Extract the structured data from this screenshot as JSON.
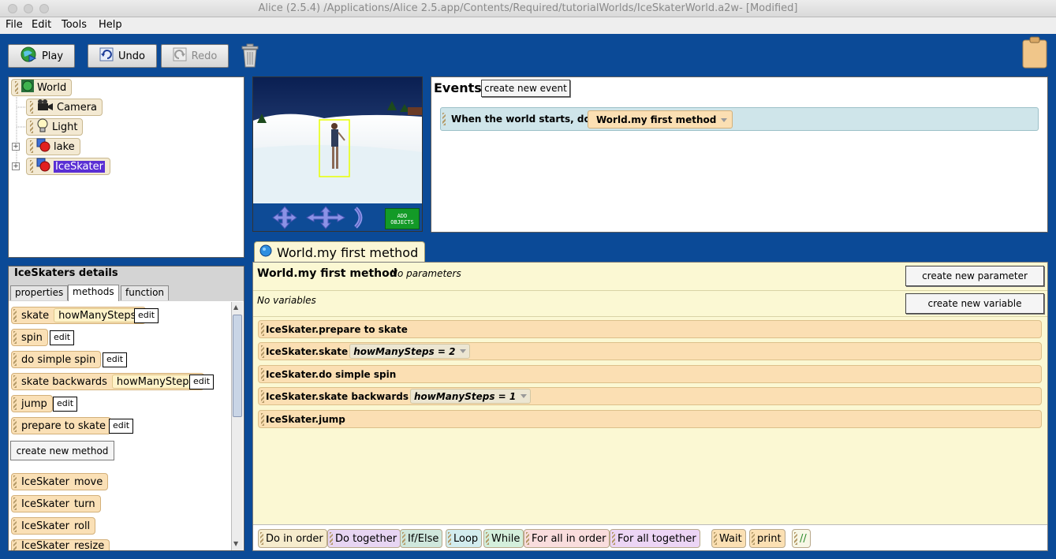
{
  "window": {
    "title": "Alice (2.5.4) /Applications/Alice 2.5.app/Contents/Required/tutorialWorlds/IceSkaterWorld.a2w-  [Modified]"
  },
  "menu": [
    {
      "label": "File"
    },
    {
      "label": "Edit"
    },
    {
      "label": "Tools"
    },
    {
      "label": "Help"
    }
  ],
  "toolbar": {
    "play": "Play",
    "undo": "Undo",
    "redo": "Redo"
  },
  "object_tree": {
    "world": "World",
    "camera": "Camera",
    "light": "Light",
    "lake": "lake",
    "iceskater": "IceSkater"
  },
  "scene": {
    "add_objects": "ADD\nOBJECTS"
  },
  "details": {
    "title": "IceSkaters details",
    "tabs": {
      "properties": "properties",
      "methods": "methods",
      "function": "function"
    },
    "edit_label": "edit",
    "methods": [
      {
        "name": "skate",
        "param": "howManySteps"
      },
      {
        "name": "spin",
        "param": ""
      },
      {
        "name": "do simple spin",
        "param": ""
      },
      {
        "name": "skate backwards",
        "param": "howManySteps"
      },
      {
        "name": "jump",
        "param": ""
      },
      {
        "name": "prepare to skate",
        "param": ""
      }
    ],
    "create_new_method": "create new method",
    "builtin": [
      {
        "obj": "IceSkater",
        "name": "move"
      },
      {
        "obj": "IceSkater",
        "name": "turn"
      },
      {
        "obj": "IceSkater",
        "name": "roll"
      },
      {
        "obj": "IceSkater",
        "name": "resize"
      }
    ]
  },
  "events": {
    "title": "Events",
    "create_new_event": "create new event",
    "when_text": "When the world starts,  do",
    "method": "World.my first method"
  },
  "editor": {
    "tab_label": "World.my first method",
    "header_name": "World.my first method",
    "no_parameters": "No parameters",
    "no_variables": "No variables",
    "create_new_parameter": "create new parameter",
    "create_new_variable": "create new variable",
    "statements": [
      {
        "text": "IceSkater.prepare to skate",
        "arg": ""
      },
      {
        "text": "IceSkater.skate",
        "arg": "howManySteps = 2"
      },
      {
        "text": "IceSkater.do simple spin",
        "arg": ""
      },
      {
        "text": "IceSkater.skate backwards",
        "arg": "howManySteps = 1"
      },
      {
        "text": "IceSkater.jump",
        "arg": ""
      }
    ]
  },
  "controls": [
    {
      "label": "Do in order",
      "color": "#f6eccd"
    },
    {
      "label": "Do together",
      "color": "#e7d5f3"
    },
    {
      "label": "If/Else",
      "color": "#cfe7dc"
    },
    {
      "label": "Loop",
      "color": "#d2ecee"
    },
    {
      "label": "While",
      "color": "#d4efdc"
    },
    {
      "label": "For all in order",
      "color": "#f9dddd"
    },
    {
      "label": "For all together",
      "color": "#ecd5f5"
    },
    {
      "label": "Wait",
      "color": "#fbe0b3"
    },
    {
      "label": "print",
      "color": "#fbe0b3"
    },
    {
      "label": "//",
      "color": "#f7f7e6"
    }
  ]
}
